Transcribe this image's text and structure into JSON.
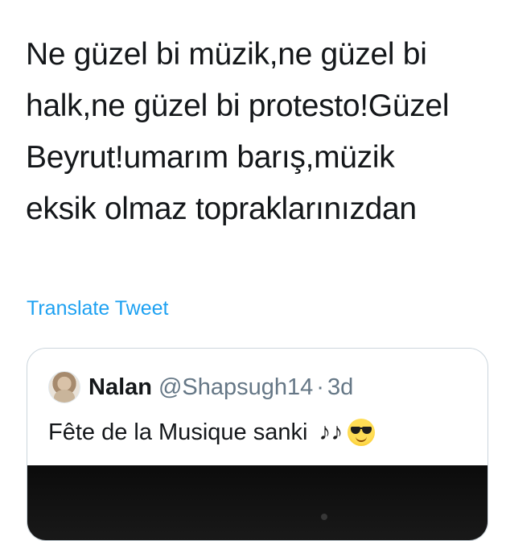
{
  "tweet": {
    "text_lines": [
      "Ne güzel bi müzik,ne güzel bi",
      "halk,ne güzel bi protesto!Güzel",
      "Beyrut!umarım barış,müzik",
      "eksik olmaz topraklarınızdan"
    ],
    "translate_label": "Translate Tweet"
  },
  "quote": {
    "display_name": "Nalan",
    "handle": "@Shapsugh14",
    "separator": "·",
    "time": "3d",
    "text": "Fête de la Musique sanki",
    "icons": [
      "musical-notes-icon",
      "sunglasses-face-icon"
    ],
    "avatar_icon": "avatar"
  },
  "colors": {
    "text": "#14171a",
    "secondary": "#657786",
    "link": "#1da1f2",
    "border": "#ccd6dd"
  }
}
